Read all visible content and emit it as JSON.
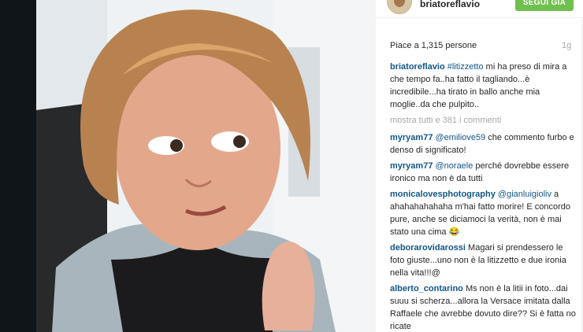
{
  "header": {
    "username": "briatoreflavio",
    "follow_label": "SEGUI GIÀ"
  },
  "likes": "Piace a 1,315 persone",
  "time": "1g",
  "caption": {
    "user": "briatoreflavio",
    "hashtag": "#litizzetto",
    "text": " mi ha preso di mira a che tempo fa..ha fatto il tagliando...è incredibile...ha tirato in ballo anche mia moglie..da che pulpito.."
  },
  "more_comments": "mostra tutti e 381 i commenti",
  "comments": [
    {
      "user": "myryam77",
      "mention": "@emiliove59",
      "text": " che commento furbo e denso di significato!"
    },
    {
      "user": "myryam77",
      "mention": "@noraele",
      "text": " perché dovrebbe essere ironico ma non è da tutti"
    },
    {
      "user": "monicalovesphotography",
      "mention": "@gianluigioliv",
      "text": " a ahahahahahaha m'hai fatto morire! E concordo pure, anche se diciamoci la verità, non è mai stato una cima 😂"
    },
    {
      "user": "deborarovidarossi",
      "mention": "",
      "text": " Magari si prendessero le foto giuste...uno non è la litizzetto e due ironia nella vita!!!@"
    },
    {
      "user": "alberto_contarino",
      "mention": "",
      "text": " Ms non è la litii in foto...dai suuu si scherza...allora la Versace imitata dalla Raffaele che avrebbe dovuto dire?? Si è fatta no ricate"
    }
  ],
  "colors": {
    "username_link": "#125688",
    "follow_button": "#70c050",
    "muted_text": "#a5a7aa",
    "page_background": "#0f1518"
  }
}
